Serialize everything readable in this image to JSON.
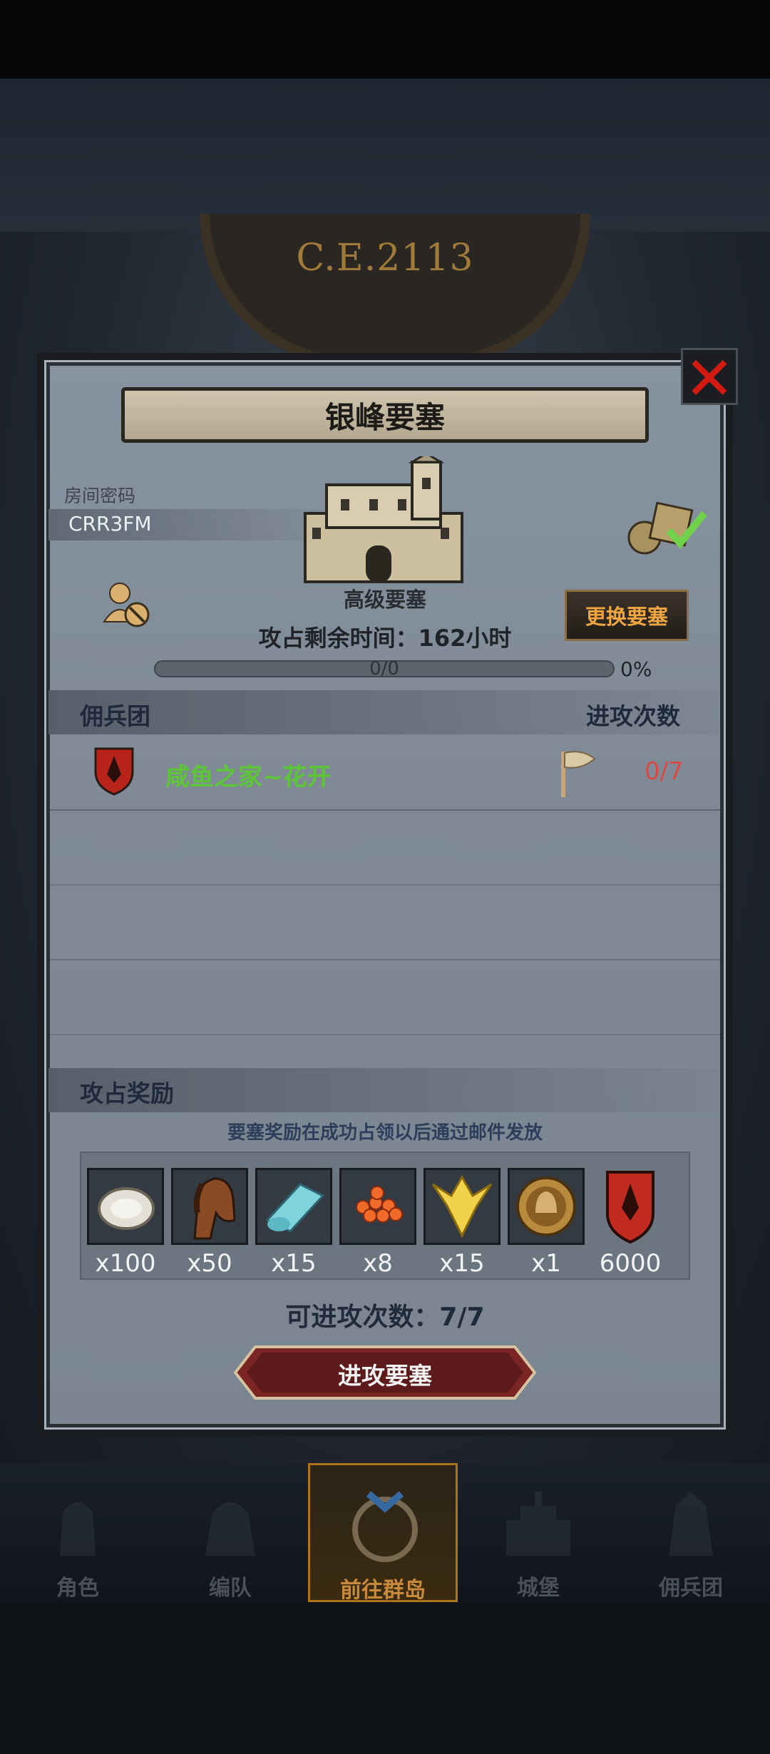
{
  "header": {
    "era_label": "C.E.2113"
  },
  "fortress": {
    "title": "银峰要塞",
    "room_password_label": "房间密码",
    "room_password": "CRR3FM",
    "grade_label": "高级要塞",
    "time_remaining": "攻占剩余时间：162小时",
    "change_button": "更换要塞",
    "progress_text": "0/0",
    "progress_percent": "0%",
    "progress_value": 0
  },
  "mercenaries": {
    "section_title": "佣兵团",
    "attacks_header": "进攻次数",
    "rows": [
      {
        "name": "咸鱼之家~花开",
        "count": "0/7"
      }
    ]
  },
  "rewards": {
    "section_title": "攻占奖励",
    "note": "要塞奖励在成功占领以后通过邮件发放",
    "items": [
      {
        "icon": "oyster-icon",
        "qty": "x100"
      },
      {
        "icon": "horse-icon",
        "qty": "x50"
      },
      {
        "icon": "cloth-icon",
        "qty": "x15"
      },
      {
        "icon": "roe-icon",
        "qty": "x8"
      },
      {
        "icon": "golden-wing-icon",
        "qty": "x15"
      },
      {
        "icon": "knight-medal-icon",
        "qty": "x1"
      },
      {
        "icon": "guild-shield-icon",
        "qty": "6000"
      }
    ]
  },
  "attack": {
    "attempts_text": "可进攻次数：7/7",
    "button": "进攻要塞"
  },
  "nav": {
    "items": [
      {
        "label": "角色",
        "icon": "knight-icon"
      },
      {
        "label": "编队",
        "icon": "formation-icon"
      },
      {
        "label": "前往群岛",
        "icon": "globe-icon",
        "active": true
      },
      {
        "label": "城堡",
        "icon": "castle-icon"
      },
      {
        "label": "佣兵团",
        "icon": "mercenary-icon"
      }
    ]
  },
  "colors": {
    "accent_gold": "#f0a640",
    "guild_name_green": "#5ec43a",
    "count_red": "#d94a45",
    "close_red": "#d21a12"
  }
}
